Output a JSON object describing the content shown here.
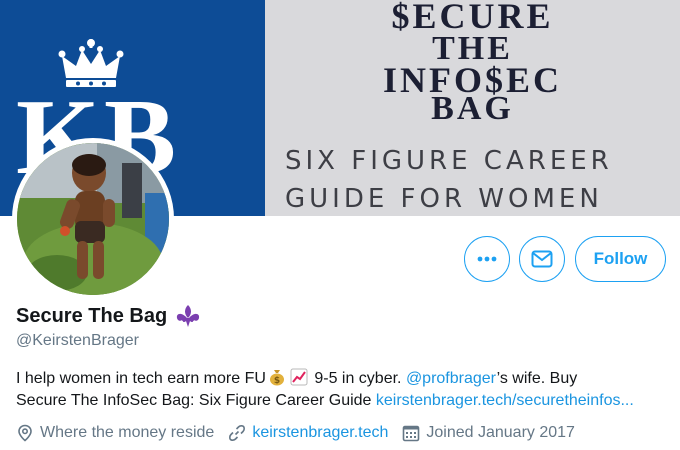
{
  "banner": {
    "monogram": "KB",
    "title_lines": [
      "$ECURE",
      "THE",
      "INFO$EC",
      "BAG"
    ],
    "subtitle_lines": [
      "SIX FIGURE CAREER",
      "GUIDE FOR WOMEN"
    ]
  },
  "actions": {
    "more_icon": "more-icon",
    "message_icon": "mail-icon",
    "follow_label": "Follow"
  },
  "profile": {
    "name": "Secure The Bag",
    "name_emoji": "fleur-de-lis-icon",
    "handle": "@KeirstenBrager",
    "bio": {
      "part1": "I help women in tech earn more FU",
      "emoji1": "money-bag-icon",
      "emoji2": "chart-up-icon",
      "part2": " 9-5 in cyber. ",
      "mention": "@profbrager",
      "part3": "’s wife. Buy",
      "line2": "Secure The InfoSec Bag: Six Figure Career Guide ",
      "link": "keirstenbrager.tech/securetheinfos..."
    },
    "location": "Where the money reside",
    "website": "keirstenbrager.tech",
    "joined": "Joined January 2017"
  },
  "colors": {
    "accent": "#1da1f2",
    "link": "#1b95e0",
    "banner_blue": "#0d4c96",
    "banner_gray": "#d9d9dc",
    "secondary_text": "#657786"
  }
}
